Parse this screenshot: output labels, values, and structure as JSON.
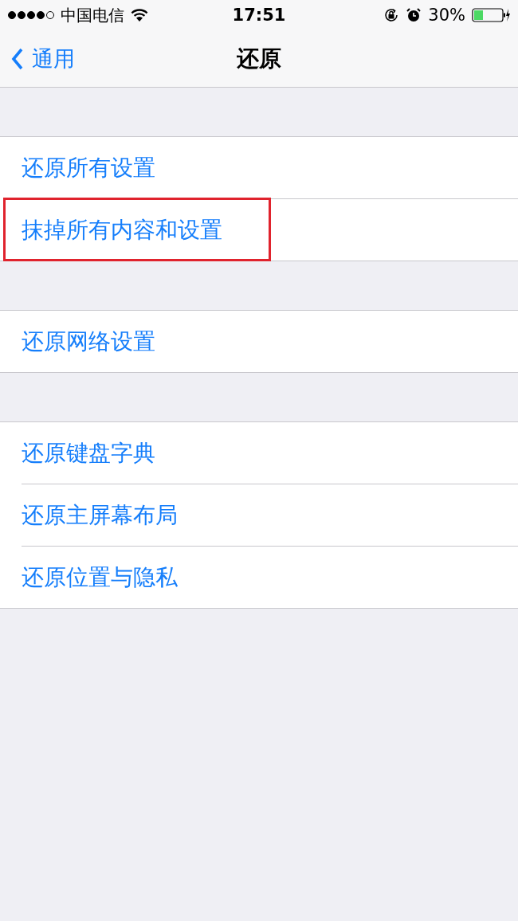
{
  "status_bar": {
    "carrier": "中国电信",
    "time": "17:51",
    "battery": "30%"
  },
  "nav_bar": {
    "back": "通用",
    "title": "还原"
  },
  "groups": [
    {
      "items": [
        {
          "label": "还原所有设置",
          "highlighted": false
        },
        {
          "label": "抹掉所有内容和设置",
          "highlighted": true
        }
      ]
    },
    {
      "items": [
        {
          "label": "还原网络设置",
          "highlighted": false
        }
      ]
    },
    {
      "items": [
        {
          "label": "还原键盘字典",
          "highlighted": false
        },
        {
          "label": "还原主屏幕布局",
          "highlighted": false
        },
        {
          "label": "还原位置与隐私",
          "highlighted": false
        }
      ]
    }
  ]
}
